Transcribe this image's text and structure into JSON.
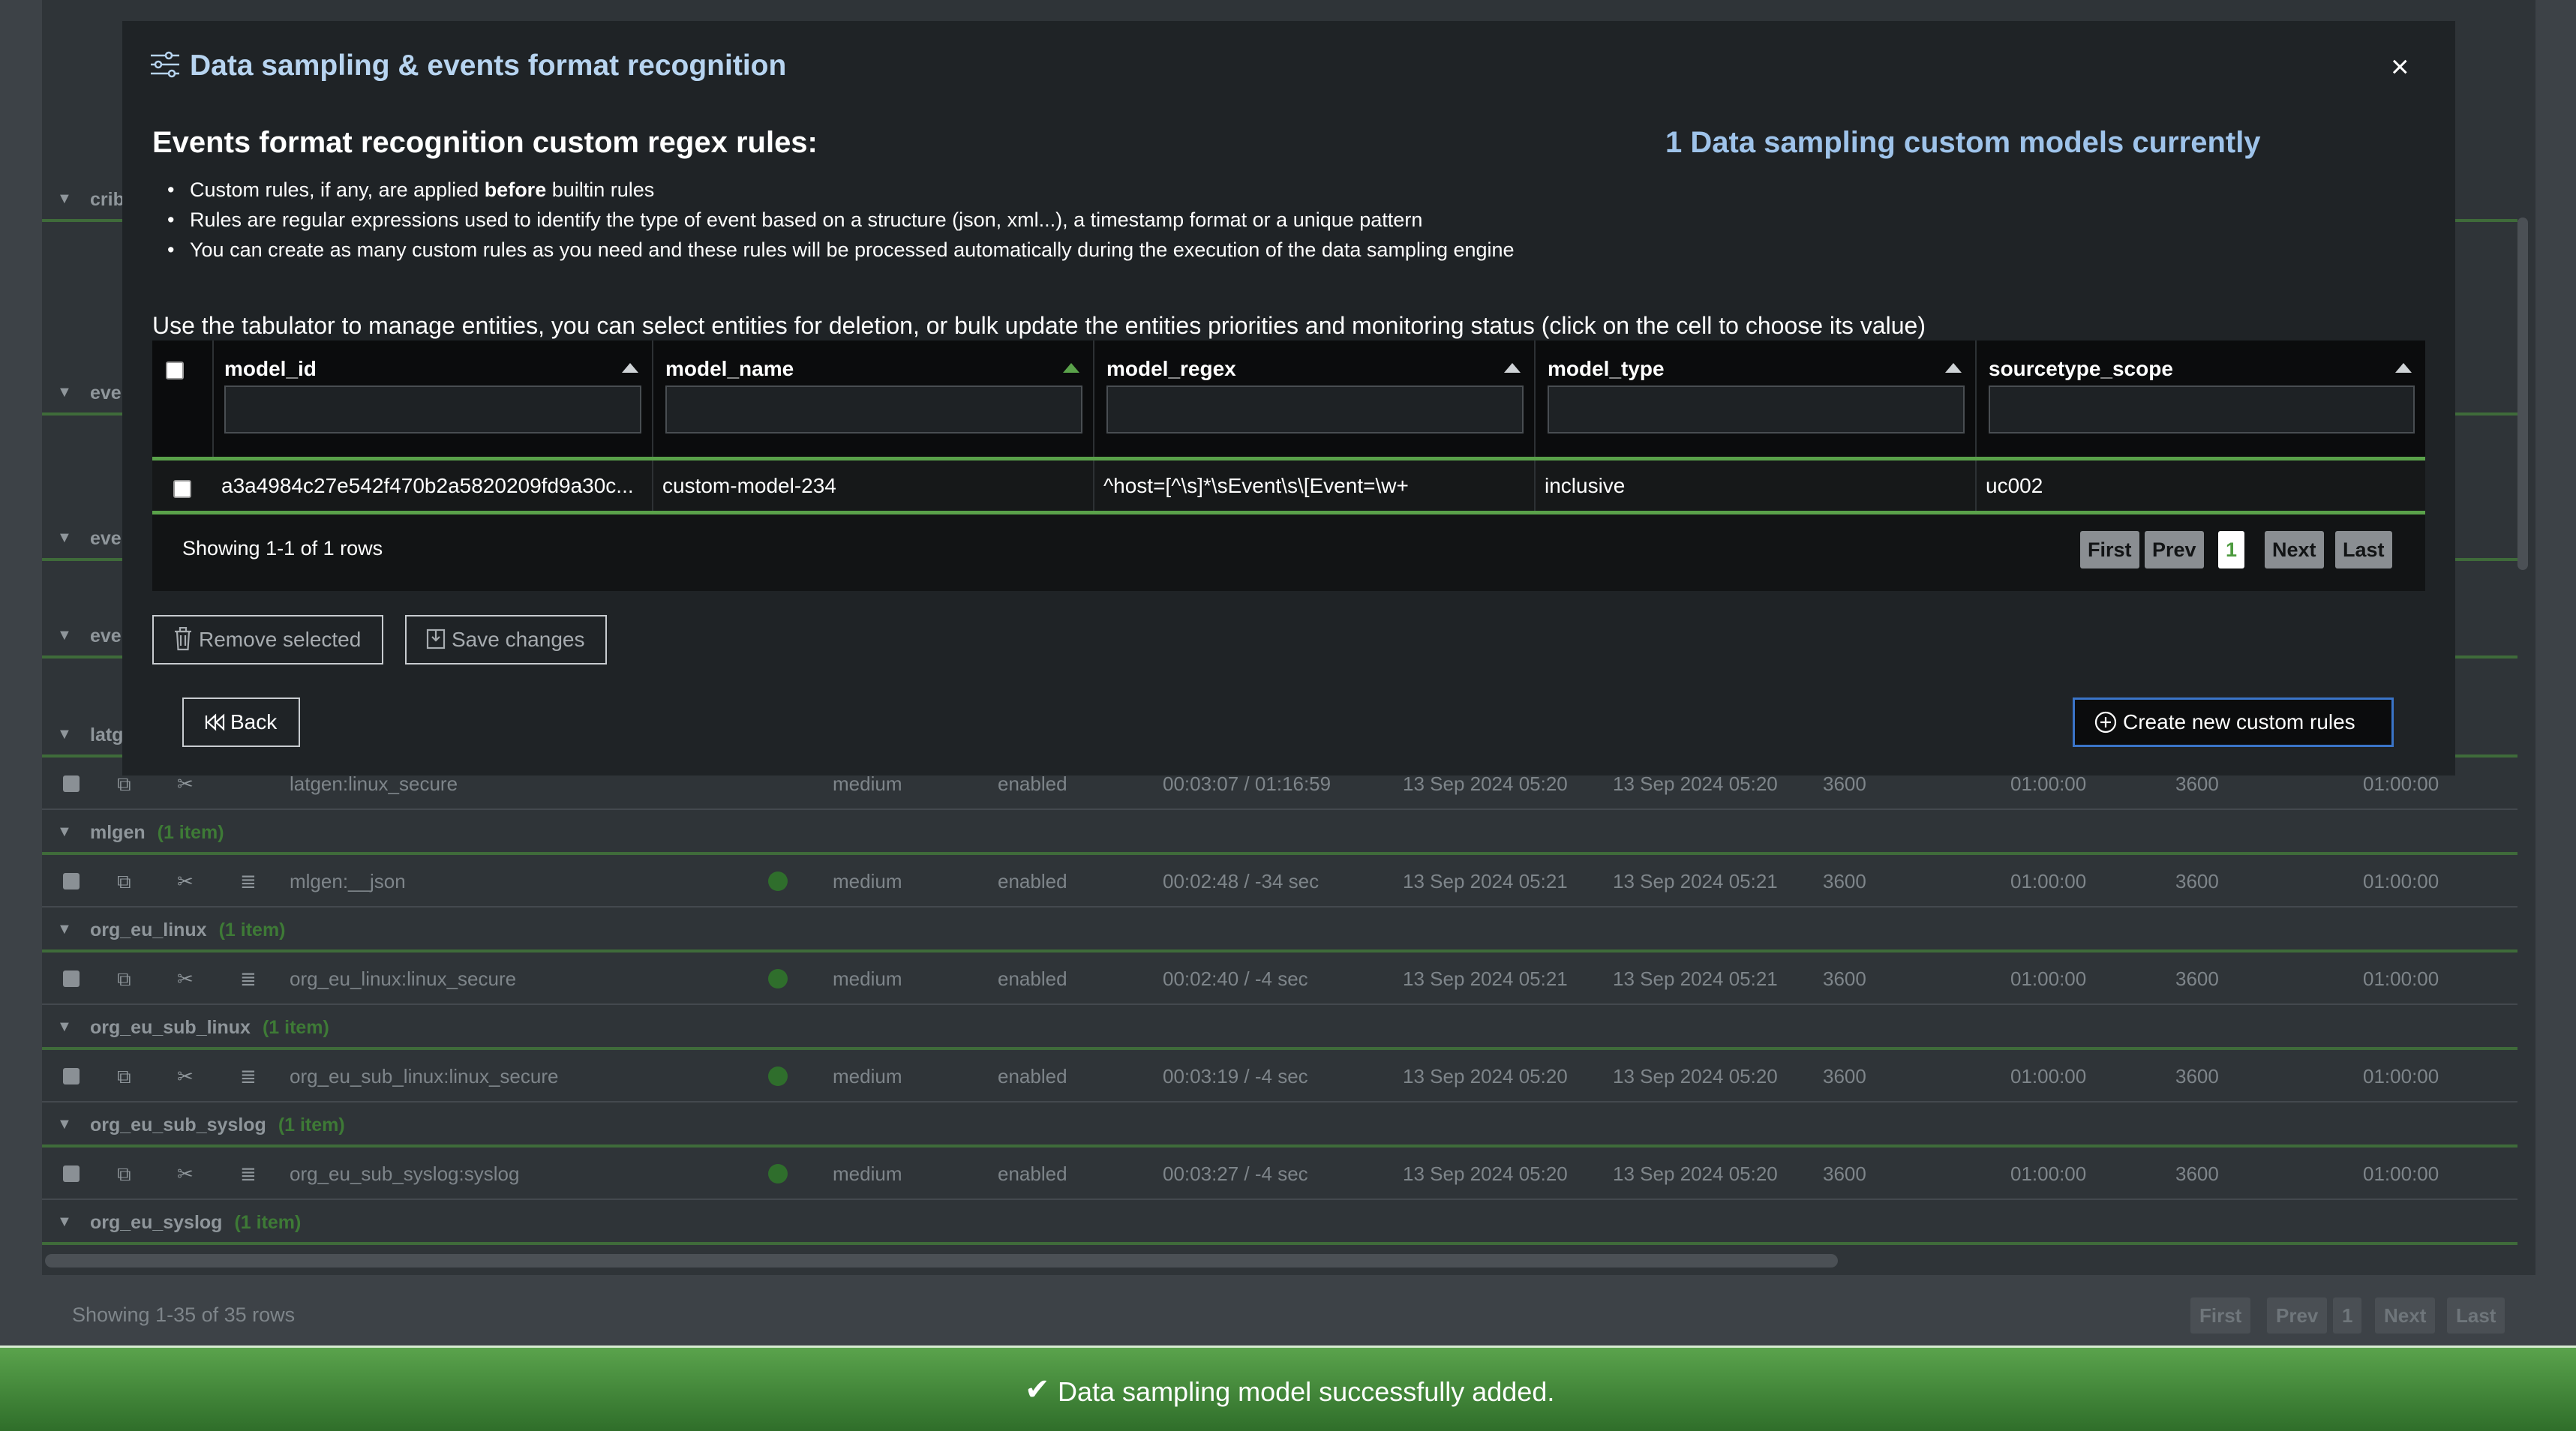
{
  "modal": {
    "title": "Data sampling & events format recognition",
    "close_label": "×",
    "section_title": "Events format recognition custom regex rules:",
    "models_count_text": "1 Data sampling custom models currently",
    "bullets": {
      "b1_prefix": "Custom rules, if any, are applied ",
      "b1_bold": "before",
      "b1_suffix": " builtin rules",
      "b2": "Rules are regular expressions used to identify the type of event based on a structure (json, xml...), a timestamp format or a unique pattern",
      "b3": "You can create as many custom rules as you need and these rules will be processed automatically during the execution of the data sampling engine"
    },
    "instructions": "Use the tabulator to manage entities, you can select entities for deletion, or bulk update the entities priorities and monitoring status (click on the cell to choose its value)",
    "table": {
      "columns": [
        "model_id",
        "model_name",
        "model_regex",
        "model_type",
        "sourcetype_scope"
      ],
      "rows": [
        {
          "model_id": "a3a4984c27e542f470b2a5820209fd9a30c...",
          "model_name": "custom-model-234",
          "model_regex": "^host=[^\\s]*\\sEvent\\s\\[Event=\\w+",
          "model_type": "inclusive",
          "sourcetype_scope": "uc002"
        }
      ],
      "showing": "Showing 1-1 of 1 rows",
      "pagination": {
        "first": "First",
        "prev": "Prev",
        "current": "1",
        "next": "Next",
        "last": "Last"
      }
    },
    "buttons": {
      "remove_selected": "Remove selected",
      "save_changes": "Save changes",
      "back": "Back",
      "create": "Create new custom rules"
    }
  },
  "background": {
    "groups": [
      {
        "name": "mlgen",
        "count": "(1 item)"
      },
      {
        "name": "org_eu_linux",
        "count": "(1 item)"
      },
      {
        "name": "org_eu_sub_linux",
        "count": "(1 item)"
      },
      {
        "name": "org_eu_sub_syslog",
        "count": "(1 item)"
      },
      {
        "name": "org_eu_syslog",
        "count": "(1 item)"
      }
    ],
    "partial_groups": [
      "crib",
      "eve",
      "eve",
      "eve",
      "latg"
    ],
    "rows": [
      {
        "name": "latgen:linux_secure",
        "priority": "medium",
        "state": "enabled",
        "latency": "00:03:07 / 01:16:59",
        "first": "13 Sep 2024 05:20",
        "last": "13 Sep 2024 05:20",
        "a": "3600",
        "b": "01:00:00",
        "c": "3600",
        "d": "01:00:00"
      },
      {
        "name": "mlgen:__json",
        "priority": "medium",
        "state": "enabled",
        "latency": "00:02:48 / -34 sec",
        "first": "13 Sep 2024 05:21",
        "last": "13 Sep 2024 05:21",
        "a": "3600",
        "b": "01:00:00",
        "c": "3600",
        "d": "01:00:00"
      },
      {
        "name": "org_eu_linux:linux_secure",
        "priority": "medium",
        "state": "enabled",
        "latency": "00:02:40 / -4 sec",
        "first": "13 Sep 2024 05:21",
        "last": "13 Sep 2024 05:21",
        "a": "3600",
        "b": "01:00:00",
        "c": "3600",
        "d": "01:00:00"
      },
      {
        "name": "org_eu_sub_linux:linux_secure",
        "priority": "medium",
        "state": "enabled",
        "latency": "00:03:19 / -4 sec",
        "first": "13 Sep 2024 05:20",
        "last": "13 Sep 2024 05:20",
        "a": "3600",
        "b": "01:00:00",
        "c": "3600",
        "d": "01:00:00"
      },
      {
        "name": "org_eu_sub_syslog:syslog",
        "priority": "medium",
        "state": "enabled",
        "latency": "00:03:27 / -4 sec",
        "first": "13 Sep 2024 05:20",
        "last": "13 Sep 2024 05:20",
        "a": "3600",
        "b": "01:00:00",
        "c": "3600",
        "d": "01:00:00"
      }
    ],
    "showing": "Showing 1-35 of 35 rows",
    "pagination": {
      "first": "First",
      "prev": "Prev",
      "current": "1",
      "next": "Next",
      "last": "Last"
    }
  },
  "toast": {
    "icon": "check-icon",
    "message": "Data sampling model successfully added."
  },
  "colors": {
    "accent_green": "#5aa24a",
    "title_blue": "#b7d4f0",
    "create_border": "#3a74c8",
    "toast_green": "#4a9440"
  }
}
